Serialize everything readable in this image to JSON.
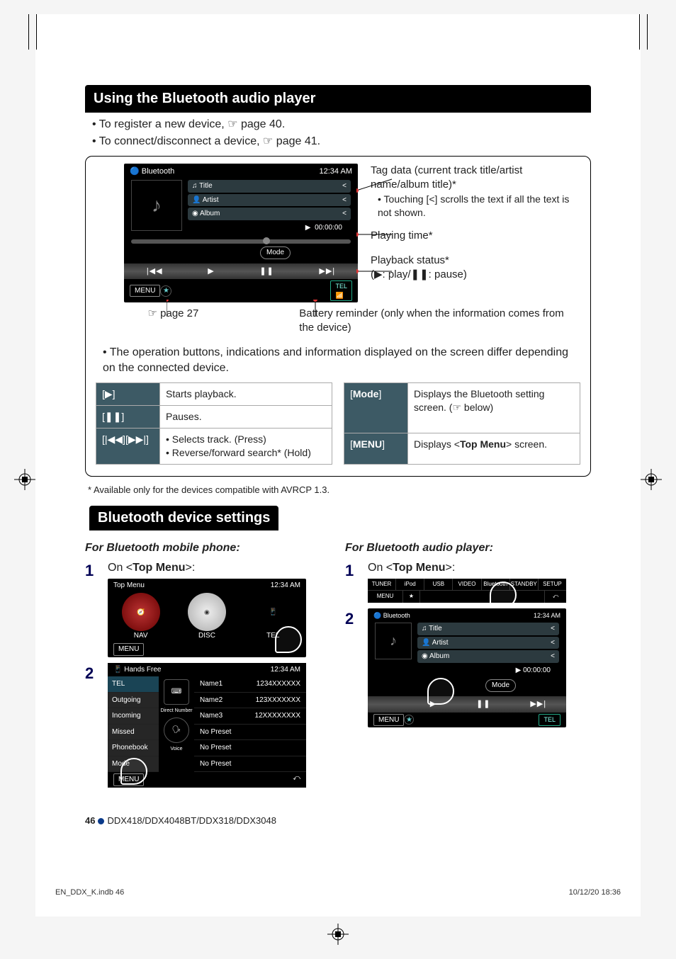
{
  "reg": {},
  "section1": {
    "title": "Using the Bluetooth audio player",
    "bullets": [
      "To register a new device, ☞ page 40.",
      "To connect/disconnect a device, ☞ page 41."
    ]
  },
  "bt_screen": {
    "header_left": "Bluetooth",
    "header_right": "12:34 AM",
    "fields": {
      "title": "Title",
      "artist": "Artist",
      "album": "Album"
    },
    "chevron": "<",
    "time": "00:00:00",
    "mode_btn": "Mode",
    "transport": {
      "prev": "|◀◀",
      "play": "▶",
      "pause": "❚❚",
      "next": "▶▶|"
    },
    "menu": "MENU",
    "tel": "TEL"
  },
  "annotations": {
    "tag": "Tag data (current track title/artist name/album title)*",
    "tag_sub": "Touching [<] scrolls the text if all the text is not shown.",
    "playtime": "Playing time*",
    "status": "Playback status*",
    "status_sub": "(▶: play/❚❚: pause)",
    "page27": "☞ page 27",
    "battery": "Battery reminder (only when the information comes from the device)"
  },
  "depends_note": "The operation buttons, indications and information displayed on the screen differ depending on the connected device.",
  "control_table_left": [
    {
      "k": "[▶]",
      "v_plain": "Starts playback."
    },
    {
      "k": "[❚❚]",
      "v_plain": "Pauses."
    },
    {
      "k": "[|◀◀][▶▶|]",
      "v_list": [
        "Selects track. (Press)",
        "Reverse/forward search* (Hold)"
      ]
    }
  ],
  "control_table_right": [
    {
      "k": "[Mode]",
      "v": {
        "pre": "Displays the Bluetooth setting screen. (☞ below)"
      }
    },
    {
      "k": "[MENU]",
      "v": {
        "pre": "Displays <",
        "b": "Top Menu",
        "post": "> screen."
      }
    }
  ],
  "avrcp_note": "*  Available only for the devices compatible with AVRCP 1.3.",
  "section2": {
    "title": "Bluetooth device settings",
    "phone_heading": "For Bluetooth mobile phone:",
    "audio_heading": "For Bluetooth audio player:",
    "step1_pre": "On <",
    "step1_b": "Top Menu",
    "step1_post": ">:"
  },
  "topmenu_screen": {
    "title": "Top Menu",
    "time": "12:34 AM",
    "nav": "NAV",
    "disc": "DISC",
    "tel": "TEL",
    "menu": "MENU"
  },
  "strip": {
    "items": [
      "TUNER",
      "iPod",
      "USB",
      "VIDEO",
      "Bluetooth",
      "STANDBY",
      "SETUP"
    ],
    "menu": "MENU"
  },
  "hands": {
    "title": "Hands Free",
    "time": "12:34 AM",
    "nav": [
      "TEL",
      "Outgoing",
      "Incoming",
      "Missed",
      "Phonebook",
      "Mode"
    ],
    "btn_direct": "Direct Number",
    "btn_voice": "Voice",
    "rows": [
      {
        "n": "Name1",
        "v": "1234XXXXXX"
      },
      {
        "n": "Name2",
        "v": "123XXXXXXX"
      },
      {
        "n": "Name3",
        "v": "12XXXXXXXX"
      },
      {
        "n": "No Preset",
        "v": ""
      },
      {
        "n": "No Preset",
        "v": ""
      },
      {
        "n": "No Preset",
        "v": ""
      }
    ],
    "menu": "MENU"
  },
  "bt_small": {
    "header_left": "Bluetooth",
    "header_right": "12:34 AM",
    "title": "Title",
    "artist": "Artist",
    "album": "Album",
    "time": "00:00:00",
    "mode": "Mode",
    "play": "▶",
    "pause": "❚❚",
    "next": "▶▶|",
    "menu": "MENU",
    "tel": "TEL"
  },
  "page_footer": {
    "num": "46",
    "models": "DDX418/DDX4048BT/DDX318/DDX3048"
  },
  "print_footer": {
    "left": "EN_DDX_K.indb   46",
    "right": "10/12/20   18:36"
  }
}
